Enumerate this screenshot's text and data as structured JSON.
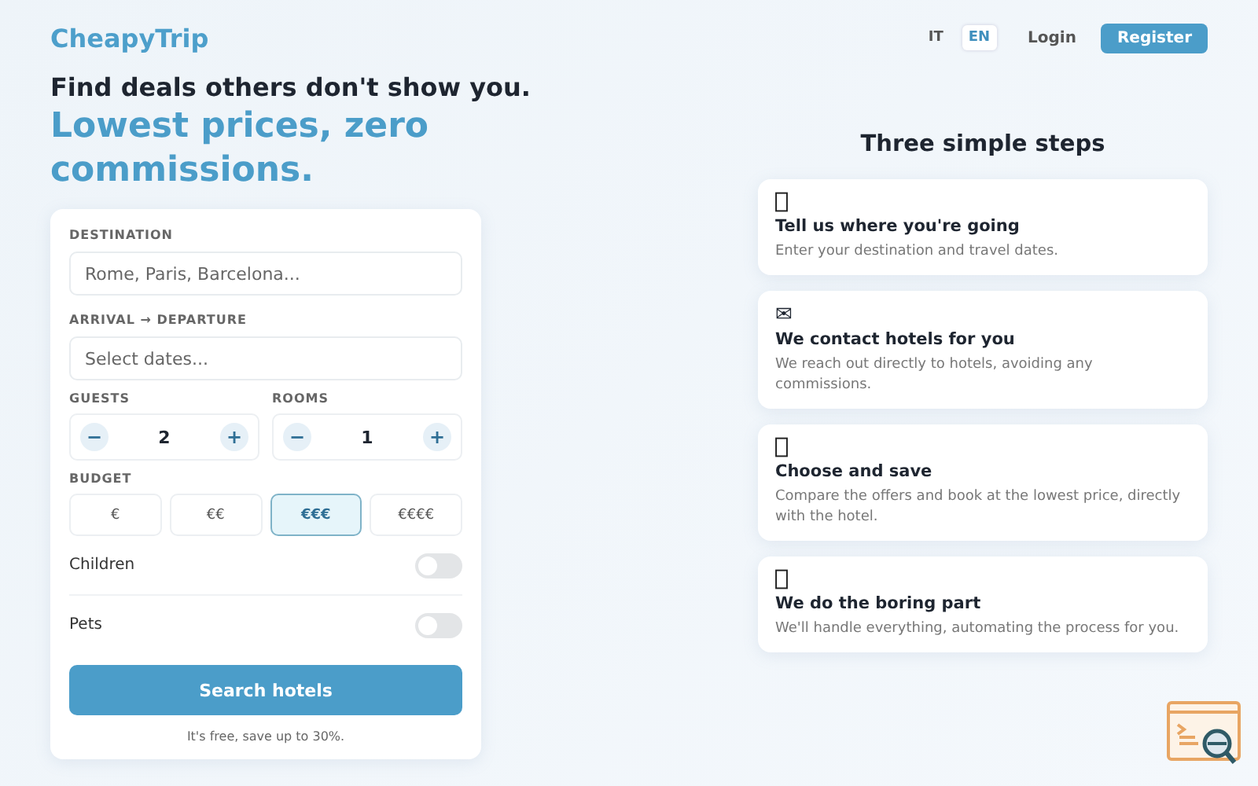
{
  "header": {
    "logo": "CheapyTrip",
    "languages": [
      {
        "label": "IT",
        "selected": false
      },
      {
        "label": "EN",
        "selected": true
      }
    ],
    "login": "Login",
    "register": "Register"
  },
  "hero": {
    "tagline": "Find deals others don't show you.",
    "headline": "Lowest prices, zero commissions."
  },
  "form": {
    "destination": {
      "label": "DESTINATION",
      "placeholder": "Rome, Paris, Barcelona..."
    },
    "dates": {
      "label": "ARRIVAL → DEPARTURE",
      "placeholder": "Select dates..."
    },
    "counters": [
      {
        "label": "GUESTS",
        "minus": "−",
        "value": "2",
        "plus": "+"
      },
      {
        "label": "ROOMS",
        "minus": "−",
        "value": "1",
        "plus": "+"
      }
    ],
    "budget": {
      "label": "BUDGET",
      "options": [
        {
          "label": "€",
          "selected": false
        },
        {
          "label": "€€",
          "selected": false
        },
        {
          "label": "€€€",
          "selected": true
        },
        {
          "label": "€€€€",
          "selected": false
        }
      ]
    },
    "toggles": [
      {
        "label": "Children",
        "on": false
      },
      {
        "label": "Pets",
        "on": false
      }
    ],
    "submit": "Search hotels",
    "note": "It's free, save up to 30%."
  },
  "steps": {
    "title": "Three simple steps",
    "items": [
      {
        "title": "Tell us where you're going",
        "text": "Enter your destination and travel dates."
      },
      {
        "glyph": "✉",
        "title": "We contact hotels for you",
        "text": "We reach out directly to hotels, avoiding any commissions."
      },
      {
        "title": "Choose and save",
        "text": "Compare the offers and book at the lowest price, directly with the hotel."
      },
      {
        "title": "We do the boring part",
        "text": "We'll handle everything, automating the process for you."
      }
    ]
  }
}
